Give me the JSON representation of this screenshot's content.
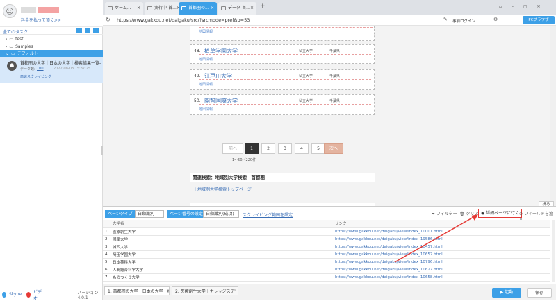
{
  "sidebar": {
    "username": "料金を払って頂く>>",
    "all_tasks": "全てのタスク",
    "folders": [
      {
        "label": "test"
      },
      {
        "label": "Samples"
      },
      {
        "label": "デフォルト"
      }
    ],
    "task": {
      "title": "首都圏の大学｜日本の大学｜検索結果一覧-...",
      "count_label": "データ数:",
      "count": "100",
      "date": "2022-08-08 15:37:25",
      "status": "高速スクレイピング"
    },
    "footer": {
      "skype": "Skype",
      "video": "ビデオ",
      "version": "バージョン: 4.0.1"
    }
  },
  "browser": {
    "tabs": [
      {
        "label": "ホーム..."
      },
      {
        "label": "実行中-首..."
      },
      {
        "label": "首都圏の..."
      },
      {
        "label": "データ-首..."
      }
    ],
    "url": "https://www.gakkou.net/daigaku/src/?srcmode=pref&p=53",
    "login": "事前ログイン",
    "pc_browser": "PCブラウザ"
  },
  "page": {
    "top_info": "地図情報",
    "entries": [
      {
        "num": "48.",
        "name": "植草学園大学",
        "type": "私立大学",
        "pref": "千葉県",
        "info": "地図情報"
      },
      {
        "num": "49.",
        "name": "江戸川大学",
        "type": "私立大学",
        "pref": "千葉県",
        "info": "地図情報"
      },
      {
        "num": "50.",
        "name": "開智国際大学",
        "type": "私立大学",
        "pref": "千葉県",
        "info": "地図情報"
      }
    ],
    "pagination": {
      "prev": "前へ",
      "pages": [
        "1",
        "2",
        "3",
        "4",
        "5"
      ],
      "next": "次へ",
      "summary": "1〜50／220件"
    },
    "related_title": "関連検索：地域別大学検索　首都圏",
    "related_link": "＋地域別大学検索トップページ"
  },
  "panel": {
    "page_type_label": "ページタイプ",
    "page_type_value": "自動識別",
    "page_num_label": "ページ番号の設定",
    "page_num_value": "自動識別(成功)",
    "scrape_range": "スクレイピング範囲を設定",
    "filter": "フィルター",
    "clear": "クリア",
    "detail": "詳細ページに行く",
    "add_field": "フィールドを追加",
    "collapse": "折る",
    "columns": [
      "大学名",
      "リンク"
    ],
    "rows": [
      {
        "n": "1",
        "name": "医療創生大学",
        "link": "https://www.gakkou.net/daigaku/view/index_10001.html"
      },
      {
        "n": "2",
        "name": "國學大学",
        "link": "https://www.gakkou.net/daigaku/view/index_19586.html"
      },
      {
        "n": "3",
        "name": "城西大学",
        "link": "https://www.gakkou.net/daigaku/view/index_10457.html"
      },
      {
        "n": "4",
        "name": "埼玉学園大学",
        "link": "https://www.gakkou.net/daigaku/view/index_10657.html"
      },
      {
        "n": "5",
        "name": "日本薬科大学",
        "link": "https://www.gakkou.net/daigaku/view/index_10796.html"
      },
      {
        "n": "6",
        "name": "人間総合科学大学",
        "link": "https://www.gakkou.net/daigaku/view/index_10627.html"
      },
      {
        "n": "7",
        "name": "ものつくり大学",
        "link": "https://www.gakkou.net/daigaku/view/index_10658.html"
      }
    ]
  },
  "statusbar": {
    "tabs": [
      {
        "label": "1. 首都圏の大学｜日本の大学｜検"
      },
      {
        "label": "2. 医療創生大学｜ナレッジステー..."
      }
    ],
    "start": "起動",
    "save": "保存"
  },
  "colors": {
    "accent": "#3da0e7",
    "annotation": "#e53935"
  }
}
